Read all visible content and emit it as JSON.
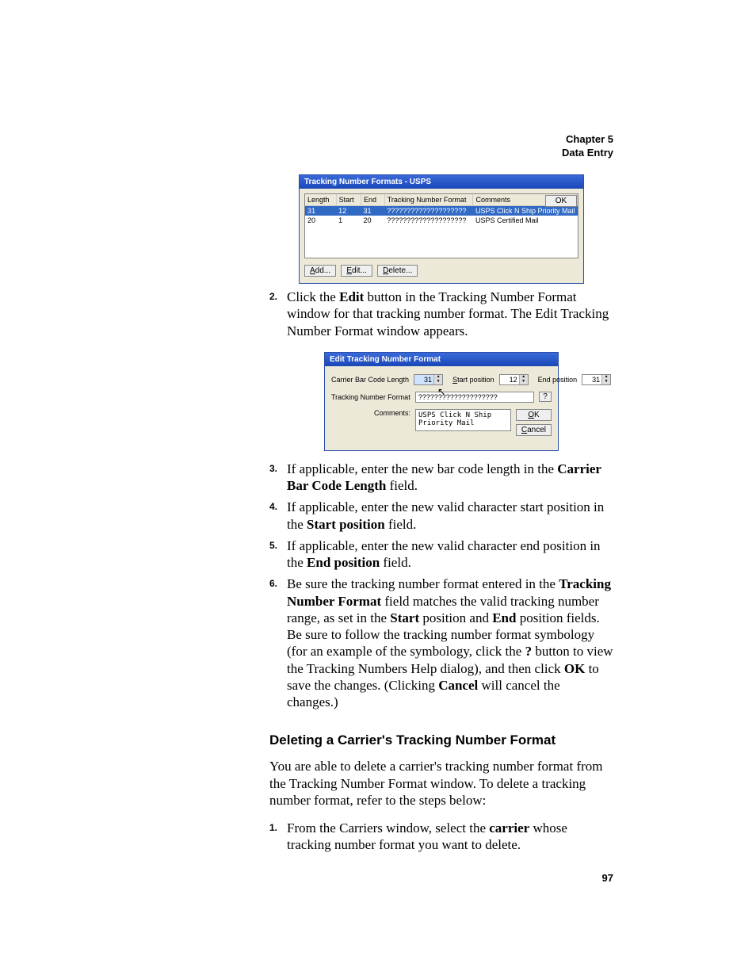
{
  "header": {
    "chapter": "Chapter 5",
    "title": "Data Entry"
  },
  "page_number": "97",
  "win1": {
    "title": "Tracking Number Formats - USPS",
    "cols": [
      "Length",
      "Start",
      "End",
      "Tracking Number Format",
      "Comments"
    ],
    "rows": [
      {
        "length": "31",
        "start": "12",
        "end": "31",
        "fmt": "????????????????????",
        "comments": "USPS Click N Ship Priority Mail"
      },
      {
        "length": "20",
        "start": "1",
        "end": "20",
        "fmt": "????????????????????",
        "comments": "USPS Certified Mail"
      }
    ],
    "buttons": {
      "add": "Add...",
      "edit": "Edit...",
      "delete": "Delete...",
      "ok": "OK"
    }
  },
  "step2": {
    "num": "2.",
    "a": "Click the ",
    "b": "Edit",
    "c": " button in the Tracking Number Format window for that tracking number format. The Edit Tracking Number Format window appears."
  },
  "win2": {
    "title": "Edit Tracking Number Format",
    "length_label": "Carrier Bar Code Length",
    "length_value": "31",
    "start_label": "Start position",
    "start_value": "12",
    "end_label": "End position",
    "end_value": "31",
    "format_label": "Tracking Number Format",
    "format_value": "????????????????????",
    "help_label": "?",
    "comments_label": "Comments:",
    "comments_value": "USPS Click N Ship Priority Mail",
    "ok": "OK",
    "cancel": "Cancel"
  },
  "step3": {
    "num": "3.",
    "a": "If applicable, enter the new bar code length in the ",
    "b": "Carrier Bar Code Length",
    "c": " field."
  },
  "step4": {
    "num": "4.",
    "a": "If applicable, enter the new valid character start position in the ",
    "b": "Start position",
    "c": " field."
  },
  "step5": {
    "num": "5.",
    "a": "If applicable, enter the new valid character end position in the ",
    "b": "End position",
    "c": " field."
  },
  "step6": {
    "num": "6.",
    "a": "Be sure the tracking number format entered in the ",
    "b": "Tracking Number Format",
    "c": " field matches the valid tracking number range, as set in the ",
    "d": "Start",
    "e": " position and ",
    "f": "End",
    "g": " position fields. Be sure to follow the tracking number format symbology (for an example of the symbology, click the ",
    "h": "?",
    "i": " button to view the Tracking Numbers Help dialog), and then click ",
    "j": "OK",
    "k": " to save the changes. (Clicking ",
    "l": "Cancel",
    "m": " will cancel the changes.)"
  },
  "section_title": "Deleting a Carrier's Tracking Number Format",
  "section_intro": "You are able to delete a carrier's tracking number format from the Tracking Number Format window. To delete a tracking number format, refer to the steps below:",
  "del1": {
    "num": "1.",
    "a": "From the Carriers window, select the ",
    "b": "carrier",
    "c": " whose tracking number format you want to delete."
  }
}
